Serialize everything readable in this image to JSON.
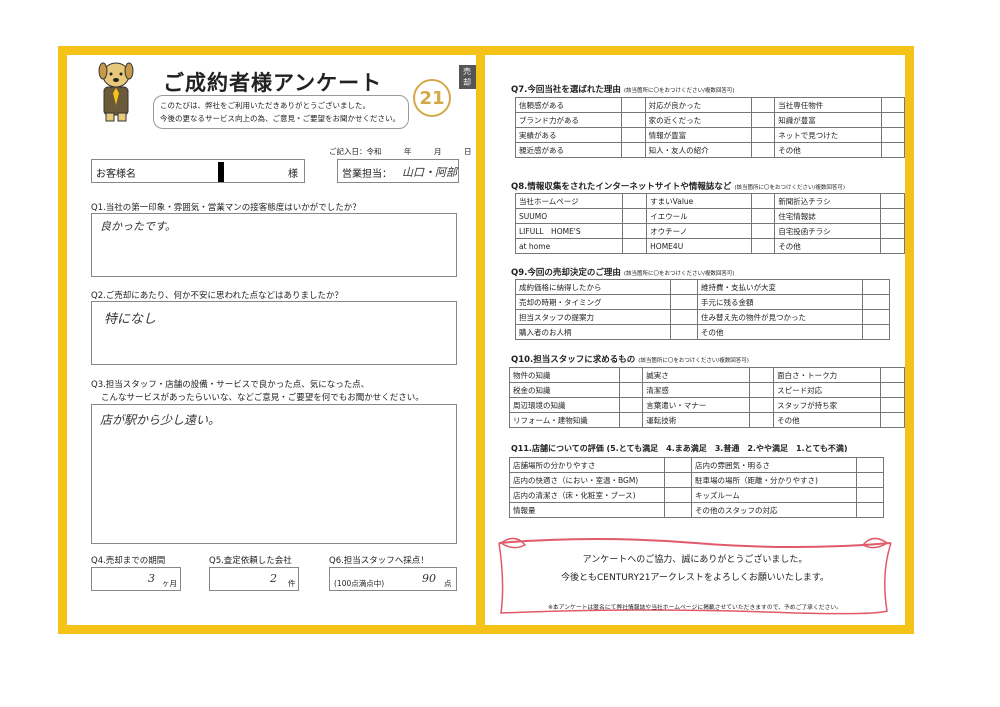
{
  "left": {
    "title": "ご成約者様アンケート",
    "greeting_line1": "このたびは、弊社をご利用いただきありがとうございました。",
    "greeting_line2": "今後の更なるサービス向上の為、ご意見・ご要望をお聞かせください。",
    "logo_text": "21",
    "tag": "売却",
    "date_label": "ご記入日：令和　　　年　　　月　　　日",
    "customer_label": "お客様名",
    "customer_suffix": "様",
    "staff_label": "営業担当：",
    "staff_value": "山口・阿部",
    "q1": "Q1.当社の第一印象・雰囲気・営業マンの接客態度はいかがでしたか？",
    "a1": "良かったです。",
    "q2": "Q2.ご売却にあたり、何か不安に思われた点などはありましたか？",
    "a2": "特になし",
    "q3_line1": "Q3.担当スタッフ・店舗の設備・サービスで良かった点、気になった点、",
    "q3_line2": "こんなサービスがあったらいいな、などご意見・ご要望を何でもお聞かせください。",
    "a3": "店が駅から少し遠い。",
    "q4": "Q4.売却までの期間",
    "a4": "3",
    "a4_unit": "ヶ月",
    "q5": "Q5.査定依頼した会社",
    "a5": "2",
    "a5_unit": "件",
    "q6": "Q6.担当スタッフへ採点！",
    "q6_note": "(100点満点中)",
    "a6": "90",
    "a6_unit": "点"
  },
  "right": {
    "q7": "Q7.今回当社を選ばれた理由",
    "q7_note": "(該当箇所に〇をおつけください/複数回答可)",
    "q7_rows": [
      [
        "信頼感がある",
        "対応が良かった",
        "当社専任物件"
      ],
      [
        "ブランド力がある",
        "家の近くだった",
        "知識が豊富"
      ],
      [
        "実績がある",
        "情報が豊富",
        "ネットで見つけた"
      ],
      [
        "親近感がある",
        "知人・友人の紹介",
        "その他"
      ]
    ],
    "q8": "Q8.情報収集をされたインターネットサイトや情報誌など",
    "q8_note": "(該当箇所に〇をおつけください/複数回答可)",
    "q8_rows": [
      [
        "当社ホームページ",
        "すまいValue",
        "新聞折込チラシ"
      ],
      [
        "SUUMO",
        "イエウール",
        "住宅情報誌"
      ],
      [
        "LIFULL　HOME'S",
        "オウチーノ",
        "自宅投函チラシ"
      ],
      [
        "at home",
        "HOME4U",
        "その他"
      ]
    ],
    "q9": "Q9.今回の売却決定のご理由",
    "q9_note": "(該当箇所に〇をおつけください/複数回答可)",
    "q9_rows": [
      [
        "成約価格に納得したから",
        "維持費・支払いが大変"
      ],
      [
        "売却の時期・タイミング",
        "手元に残る金額"
      ],
      [
        "担当スタッフの提案力",
        "住み替え先の物件が見つかった"
      ],
      [
        "購入者のお人柄",
        "その他"
      ]
    ],
    "q10": "Q10.担当スタッフに求めるもの",
    "q10_note": "(該当箇所に〇をおつけください/複数回答可)",
    "q10_rows": [
      [
        "物件の知識",
        "誠実さ",
        "面白さ・トーク力"
      ],
      [
        "税金の知識",
        "清潔感",
        "スピード対応"
      ],
      [
        "周辺環境の知識",
        "言葉遣い・マナー",
        "スタッフが持ち家"
      ],
      [
        "リフォーム・建物知識",
        "運転技術",
        "その他"
      ]
    ],
    "q11": "Q11.店舗についての評価 (5.とても満足　4.まあ満足　3.普通　2.やや満足　1.とても不満)",
    "q11_rows": [
      [
        "店舗場所の分かりやすさ",
        "店内の雰囲気・明るさ"
      ],
      [
        "店内の快適さ（におい・室温・BGM)",
        "駐車場の場所（距離・分かりやすさ)"
      ],
      [
        "店内の清潔さ（床・化粧室・ブース)",
        "キッズルーム"
      ],
      [
        "情報量",
        "その他のスタッフの対応"
      ]
    ],
    "thanks1": "アンケートへのご協力、誠にありがとうございました。",
    "thanks2": "今後ともCENTURY21アークレストをよろしくお願いいたします。",
    "note": "※本アンケートは匿名にて弊社情報誌や当社ホームページに掲載させていただきますので、予めご了承ください。"
  },
  "colors": {
    "frame": "#f5c218",
    "logo": "#d4a94a",
    "ribbon": "#e05a6a"
  }
}
